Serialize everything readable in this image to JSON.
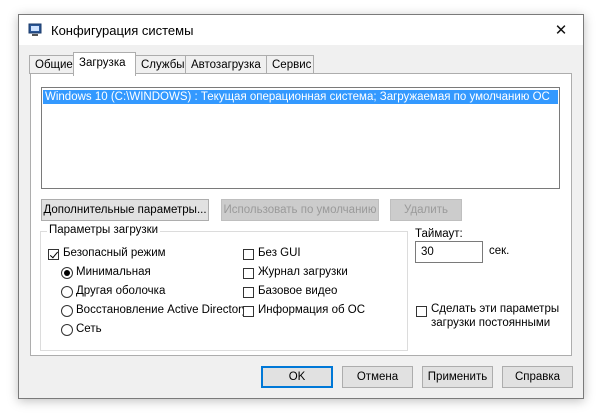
{
  "window": {
    "title": "Конфигурация системы",
    "close_icon": "close-icon"
  },
  "tabs": [
    {
      "label": "Общие",
      "active": false
    },
    {
      "label": "Загрузка",
      "active": true
    },
    {
      "label": "Службы",
      "active": false
    },
    {
      "label": "Автозагрузка",
      "active": false
    },
    {
      "label": "Сервис",
      "active": false
    }
  ],
  "boot_list": {
    "items": [
      "Windows 10 (C:\\WINDOWS) : Текущая операционная система; Загружаемая по умолчанию ОС"
    ],
    "selected": 0
  },
  "list_buttons": {
    "advanced": "Дополнительные параметры...",
    "set_default": "Использовать по умолчанию",
    "delete": "Удалить"
  },
  "boot_options": {
    "legend": "Параметры загрузки",
    "safe_boot": {
      "label": "Безопасный режим",
      "checked": true
    },
    "modes": [
      {
        "label": "Минимальная",
        "selected": true
      },
      {
        "label": "Другая оболочка",
        "selected": false
      },
      {
        "label": "Восстановление Active Directory",
        "selected": false
      },
      {
        "label": "Сеть",
        "selected": false
      }
    ],
    "no_gui": {
      "label": "Без GUI",
      "checked": false
    },
    "boot_log": {
      "label": "Журнал загрузки",
      "checked": false
    },
    "base_video": {
      "label": "Базовое видео",
      "checked": false
    },
    "os_info": {
      "label": "Информация  об ОС",
      "checked": false
    }
  },
  "timeout": {
    "label": "Таймаут:",
    "value": "30",
    "unit": "сек."
  },
  "make_permanent": {
    "label_line1": "Сделать эти параметры",
    "label_line2": "загрузки постоянными",
    "checked": false
  },
  "dialog_buttons": {
    "ok": "OK",
    "cancel": "Отмена",
    "apply": "Применить",
    "help": "Справка"
  },
  "colors": {
    "selection": "#3399ff",
    "default_button_border": "#0078d7"
  }
}
